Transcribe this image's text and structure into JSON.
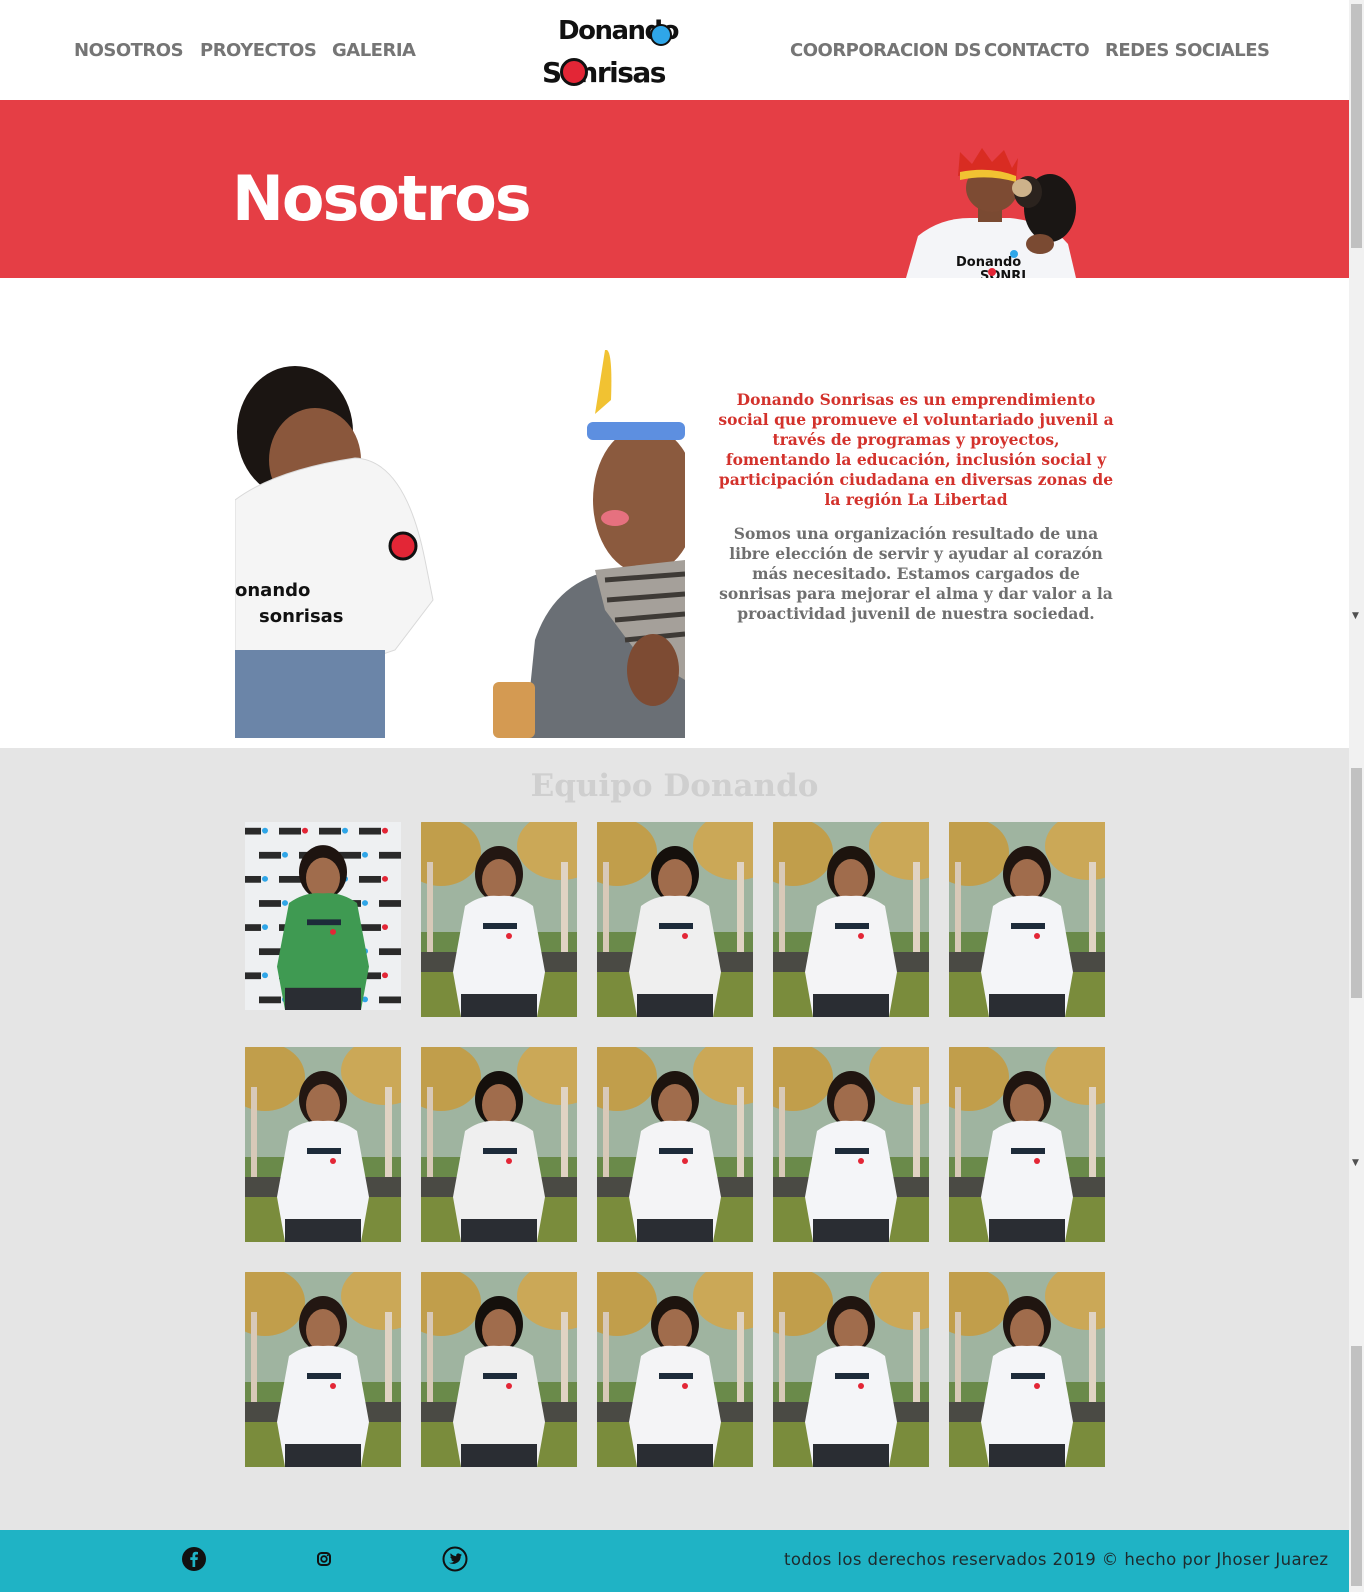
{
  "nav": {
    "left": [
      "NOSOTROS",
      "PROYECTOS",
      "GALERIA"
    ],
    "right": [
      "COORPORACION DS",
      "CONTACTO",
      "REDES SOCIALES"
    ]
  },
  "logo": {
    "line1": "Donando",
    "line2": "Sonrisas"
  },
  "hero": {
    "title": "Nosotros",
    "shirt_text_1": "Donando",
    "shirt_text_2": "SONRI"
  },
  "about": {
    "paragraph1": "Donando Sonrisas es un emprendimiento social que promueve el voluntariado juvenil a través de programas y proyectos, fomentando la educación, inclusión social y participación ciudadana en diversas zonas de la región La Libertad",
    "paragraph2": "Somos una organización resultado de una libre elección de servir y ayudar al corazón más necesitado. Estamos cargados de sonrisas para mejorar el alma y dar valor a la proactividad juvenil de nuestra sociedad.",
    "shirt_text_1": "onando",
    "shirt_text_2": "sonrisas"
  },
  "team": {
    "title": "Equipo Donando",
    "photos": [
      {
        "type": "backdrop",
        "hair": "#1e1410",
        "top": "#3f9a52"
      },
      {
        "type": "park",
        "hair": "#231712",
        "top": "#f3f4f7"
      },
      {
        "type": "park",
        "hair": "#15100c",
        "top": "#efefef"
      },
      {
        "type": "park",
        "hair": "#1d140e",
        "top": "#f4f4f6"
      },
      {
        "type": "park",
        "hair": "#201510",
        "top": "#f4f5f8"
      },
      {
        "type": "park",
        "hair": "#231712",
        "top": "#f3f4f7"
      },
      {
        "type": "park",
        "hair": "#15100c",
        "top": "#efefef"
      },
      {
        "type": "park",
        "hair": "#1d140e",
        "top": "#f4f4f6"
      },
      {
        "type": "park",
        "hair": "#201510",
        "top": "#f4f5f8"
      },
      {
        "type": "park",
        "hair": "#201510",
        "top": "#f4f5f8"
      },
      {
        "type": "park",
        "hair": "#231712",
        "top": "#f3f4f7"
      },
      {
        "type": "park",
        "hair": "#15100c",
        "top": "#efefef"
      },
      {
        "type": "park",
        "hair": "#1d140e",
        "top": "#f4f4f6"
      },
      {
        "type": "park",
        "hair": "#201510",
        "top": "#f4f5f8"
      },
      {
        "type": "park",
        "hair": "#201510",
        "top": "#f4f5f8"
      }
    ],
    "shirt_text": "Donando"
  },
  "footer": {
    "social": [
      "facebook-icon",
      "instagram-icon",
      "twitter-icon"
    ],
    "copyright": "todos los derechos reservados 2019 © hecho por Jhoser Juarez"
  },
  "colors": {
    "hero": "#e53e45",
    "footer": "#1fb3c5",
    "nav": "#757575",
    "about_highlight": "#d3322c",
    "team_bg": "#e5e5e5"
  }
}
